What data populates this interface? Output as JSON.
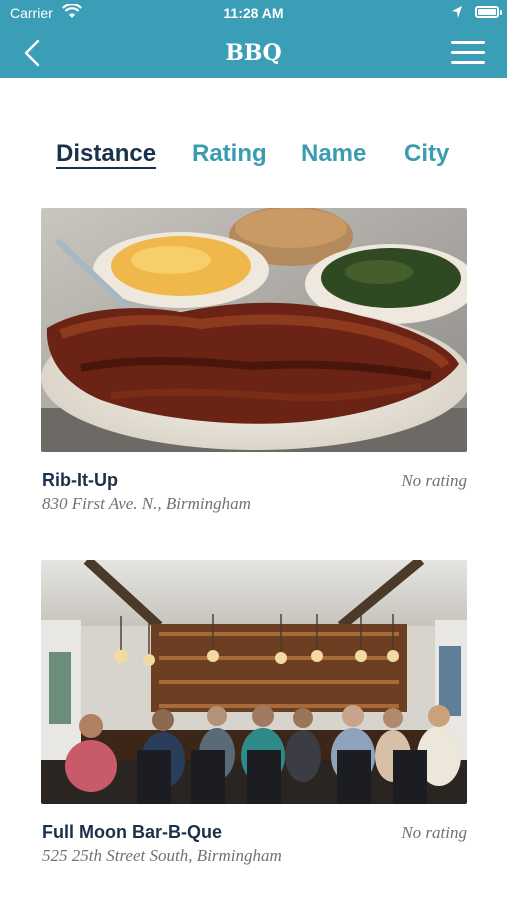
{
  "status_bar": {
    "carrier": "Carrier",
    "time": "11:28 AM"
  },
  "nav": {
    "title": "BBQ",
    "back_icon": "chevron-left-icon",
    "menu_icon": "hamburger-menu-icon"
  },
  "tabs": [
    {
      "label": "Distance",
      "active": true
    },
    {
      "label": "Rating",
      "active": false
    },
    {
      "label": "Name",
      "active": false
    },
    {
      "label": "City",
      "active": false
    }
  ],
  "restaurants": [
    {
      "name": "Rib-It-Up",
      "address": "830 First Ave. N., Birmingham",
      "rating": "No rating",
      "image": "bbq-ribs-plate-photo"
    },
    {
      "name": "Full Moon Bar-B-Que",
      "address": "525 25th Street South, Birmingham",
      "rating": "No rating",
      "image": "restaurant-interior-photo"
    }
  ],
  "colors": {
    "header": "#3a9eb6",
    "tab_active": "#17324a",
    "tab_inactive": "#3b9bb0"
  }
}
